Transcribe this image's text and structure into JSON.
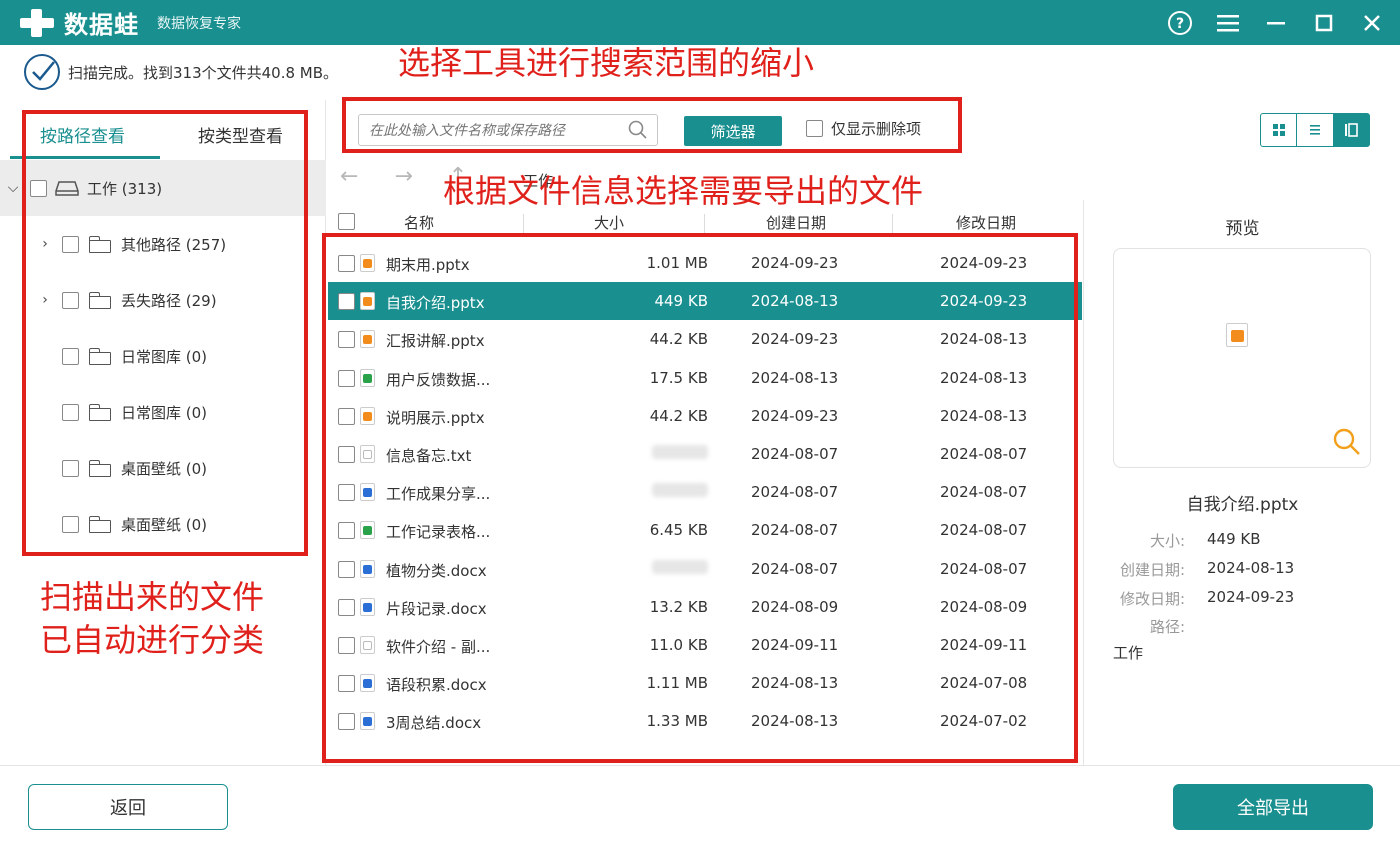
{
  "app": {
    "name": "数据蛙",
    "subtitle": "数据恢复专家"
  },
  "status": {
    "text": "扫描完成。找到313个文件共40.8 MB。"
  },
  "annotations": {
    "toolbar_note": "选择工具进行搜索范围的缩小",
    "files_note": "根据文件信息选择需要导出的文件",
    "tree_note_line1": "扫描出来的文件",
    "tree_note_line2": "已自动进行分类"
  },
  "left_panel": {
    "tab_by_path": "按路径查看",
    "tab_by_type": "按类型查看",
    "tree": [
      {
        "label": "工作 (313)",
        "level": 0,
        "expandable": true
      },
      {
        "label": "其他路径 (257)",
        "level": 1,
        "expandable": true
      },
      {
        "label": "丢失路径 (29)",
        "level": 1,
        "expandable": true
      },
      {
        "label": "日常图库 (0)",
        "level": 1,
        "expandable": false
      },
      {
        "label": "日常图库 (0)",
        "level": 1,
        "expandable": false
      },
      {
        "label": "桌面壁纸 (0)",
        "level": 1,
        "expandable": false
      },
      {
        "label": "桌面壁纸 (0)",
        "level": 1,
        "expandable": false
      }
    ]
  },
  "toolbar": {
    "search_placeholder": "在此处输入文件名称或保存路径",
    "filter_label": "筛选器",
    "only_deleted_label": "仅显示删除项"
  },
  "breadcrumb": "工作",
  "table": {
    "headers": {
      "name": "名称",
      "size": "大小",
      "created": "创建日期",
      "modified": "修改日期"
    },
    "rows": [
      {
        "name": "期末用.pptx",
        "size": "1.01 MB",
        "created": "2024-09-23",
        "modified": "2024-09-23",
        "icon": "pptx",
        "selected": false
      },
      {
        "name": "自我介绍.pptx",
        "size": "449 KB",
        "created": "2024-08-13",
        "modified": "2024-09-23",
        "icon": "pptx",
        "selected": true
      },
      {
        "name": "汇报讲解.pptx",
        "size": "44.2 KB",
        "created": "2024-09-23",
        "modified": "2024-08-13",
        "icon": "pptx",
        "selected": false
      },
      {
        "name": "用户反馈数据...",
        "size": "17.5 KB",
        "created": "2024-08-13",
        "modified": "2024-08-13",
        "icon": "xlsx",
        "selected": false
      },
      {
        "name": "说明展示.pptx",
        "size": "44.2 KB",
        "created": "2024-09-23",
        "modified": "2024-08-13",
        "icon": "pptx",
        "selected": false
      },
      {
        "name": "信息备忘.txt",
        "size": "",
        "created": "2024-08-07",
        "modified": "2024-08-07",
        "icon": "txt",
        "selected": false
      },
      {
        "name": "工作成果分享...",
        "size": "",
        "created": "2024-08-07",
        "modified": "2024-08-07",
        "icon": "docx",
        "selected": false
      },
      {
        "name": "工作记录表格...",
        "size": "6.45 KB",
        "created": "2024-08-07",
        "modified": "2024-08-07",
        "icon": "xlsx",
        "selected": false
      },
      {
        "name": "植物分类.docx",
        "size": "",
        "created": "2024-08-07",
        "modified": "2024-08-07",
        "icon": "docx",
        "selected": false
      },
      {
        "name": "片段记录.docx",
        "size": "13.2 KB",
        "created": "2024-08-09",
        "modified": "2024-08-09",
        "icon": "docx",
        "selected": false
      },
      {
        "name": "软件介绍 - 副...",
        "size": "11.0 KB",
        "created": "2024-09-11",
        "modified": "2024-09-11",
        "icon": "txt",
        "selected": false
      },
      {
        "name": "语段积累.docx",
        "size": "1.11 MB",
        "created": "2024-08-13",
        "modified": "2024-07-08",
        "icon": "docx",
        "selected": false
      },
      {
        "name": "3周总结.docx",
        "size": "1.33 MB",
        "created": "2024-08-13",
        "modified": "2024-07-02",
        "icon": "docx",
        "selected": false
      }
    ]
  },
  "preview": {
    "title": "预览",
    "file_name": "自我介绍.pptx",
    "size_label": "大小:",
    "size_value": "449 KB",
    "created_label": "创建日期:",
    "created_value": "2024-08-13",
    "modified_label": "修改日期:",
    "modified_value": "2024-09-23",
    "path_label": "路径:",
    "path_value": "工作"
  },
  "footer": {
    "back_label": "返回",
    "export_label": "全部导出"
  },
  "colors": {
    "accent": "#1a8f8f",
    "annotation_red": "#e0201b",
    "pptx_icon": "#f28c1c",
    "xlsx_icon": "#2aa24a",
    "docx_icon": "#2b6fd6"
  },
  "icons": {
    "help": "help-icon",
    "menu": "menu-icon",
    "minimize": "minimize-icon",
    "maximize": "maximize-icon",
    "close": "close-icon",
    "search": "search-icon",
    "zoom": "zoom-icon"
  }
}
